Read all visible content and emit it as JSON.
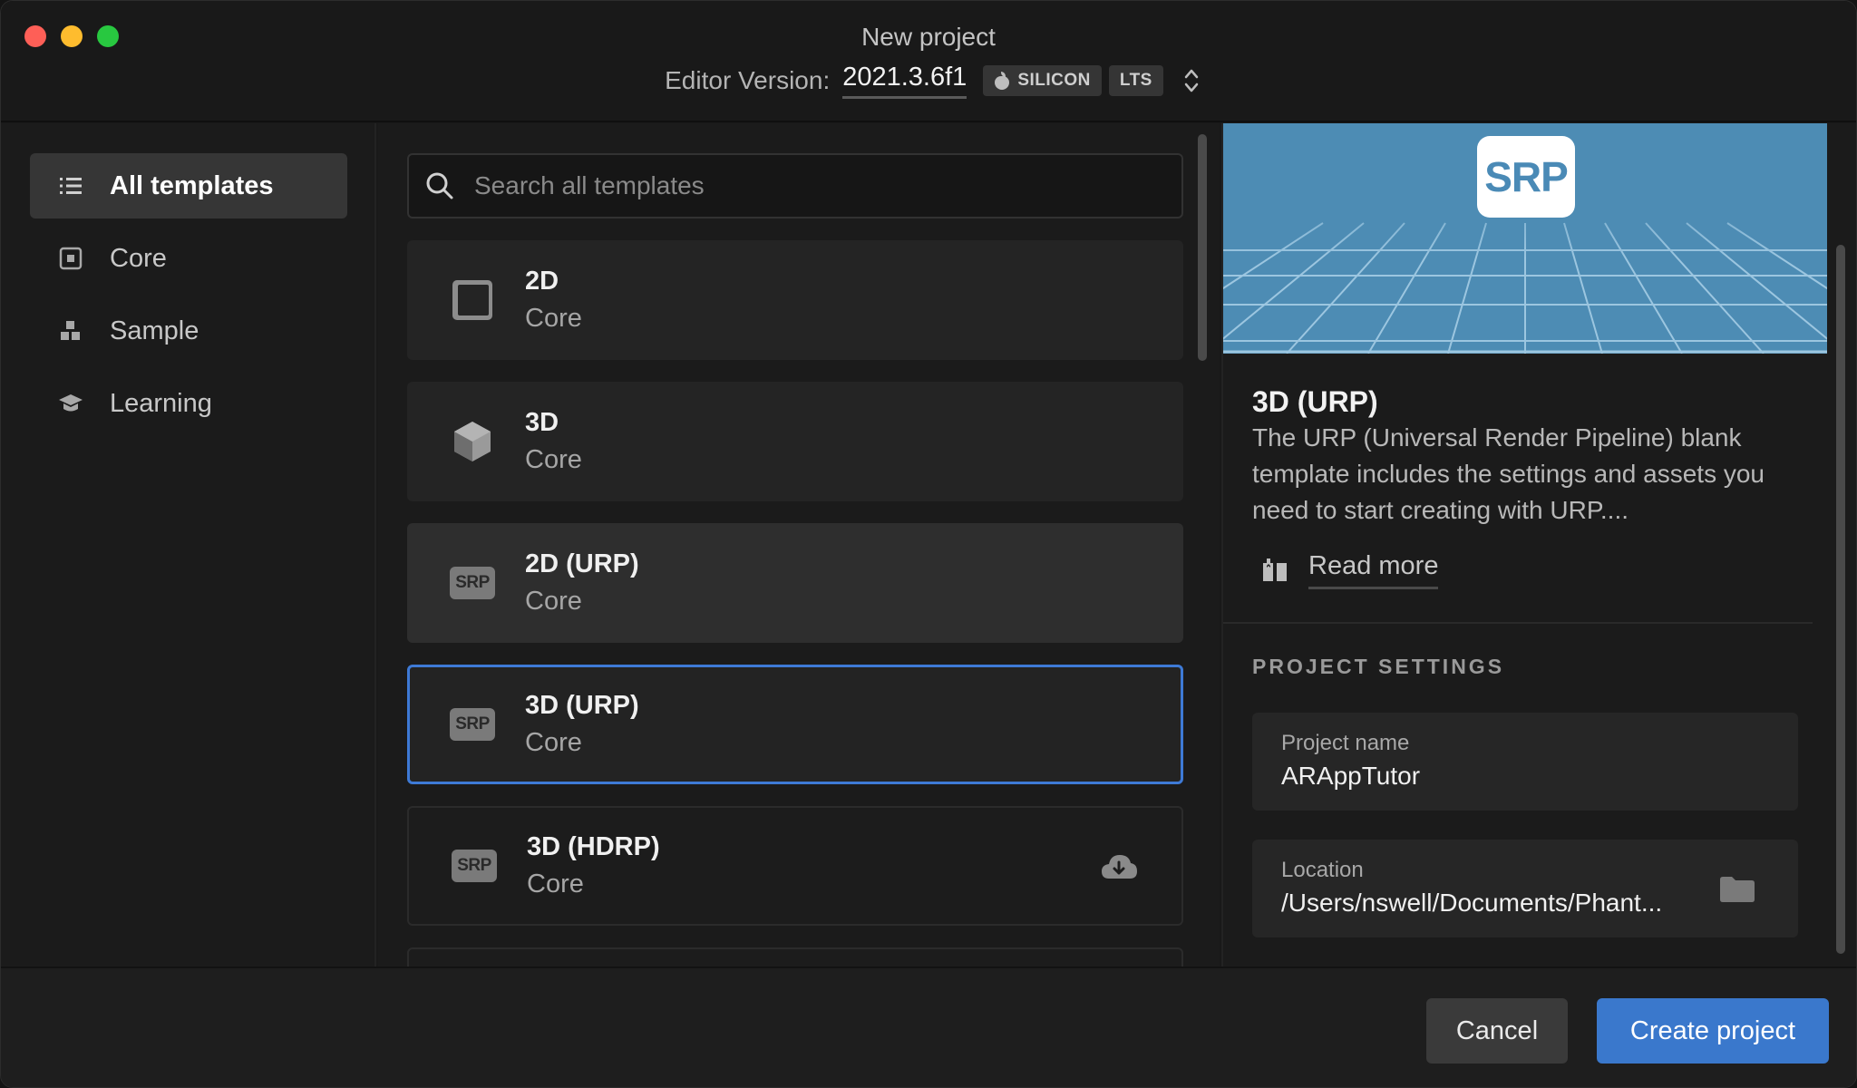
{
  "window": {
    "title": "New project"
  },
  "editor": {
    "label": "Editor Version:",
    "version": "2021.3.6f1",
    "badges": [
      "SILICON",
      "LTS"
    ]
  },
  "sidebar": {
    "items": [
      {
        "label": "All templates",
        "icon": "list-icon",
        "active": true
      },
      {
        "label": "Core",
        "icon": "core-icon",
        "active": false
      },
      {
        "label": "Sample",
        "icon": "sample-icon",
        "active": false
      },
      {
        "label": "Learning",
        "icon": "learning-icon",
        "active": false
      }
    ]
  },
  "search": {
    "placeholder": "Search all templates"
  },
  "templates": [
    {
      "name": "2D",
      "category": "Core",
      "icon": "2d-square-icon"
    },
    {
      "name": "3D",
      "category": "Core",
      "icon": "3d-cube-icon"
    },
    {
      "name": "2D (URP)",
      "category": "Core",
      "icon": "srp-icon",
      "icon_text": "SRP"
    },
    {
      "name": "3D (URP)",
      "category": "Core",
      "icon": "srp-icon",
      "icon_text": "SRP",
      "selected": true
    },
    {
      "name": "3D (HDRP)",
      "category": "Core",
      "icon": "srp-icon",
      "icon_text": "SRP",
      "download": "cloud-download-icon"
    }
  ],
  "details": {
    "logo_text": "SRP",
    "title": "3D (URP)",
    "description": "The URP (Universal Render Pipeline) blank template includes the settings and assets you need to start creating with URP....",
    "read_more": "Read more",
    "settings_title": "PROJECT SETTINGS",
    "project_name_label": "Project name",
    "project_name_value": "ARAppTutor",
    "location_label": "Location",
    "location_value": "/Users/nswell/Documents/Phant..."
  },
  "footer": {
    "cancel_label": "Cancel",
    "create_label": "Create project"
  },
  "colors": {
    "accent": "#3a78cc",
    "selected_border": "#3e7ad6",
    "preview_bg": "#4d8cb4"
  }
}
